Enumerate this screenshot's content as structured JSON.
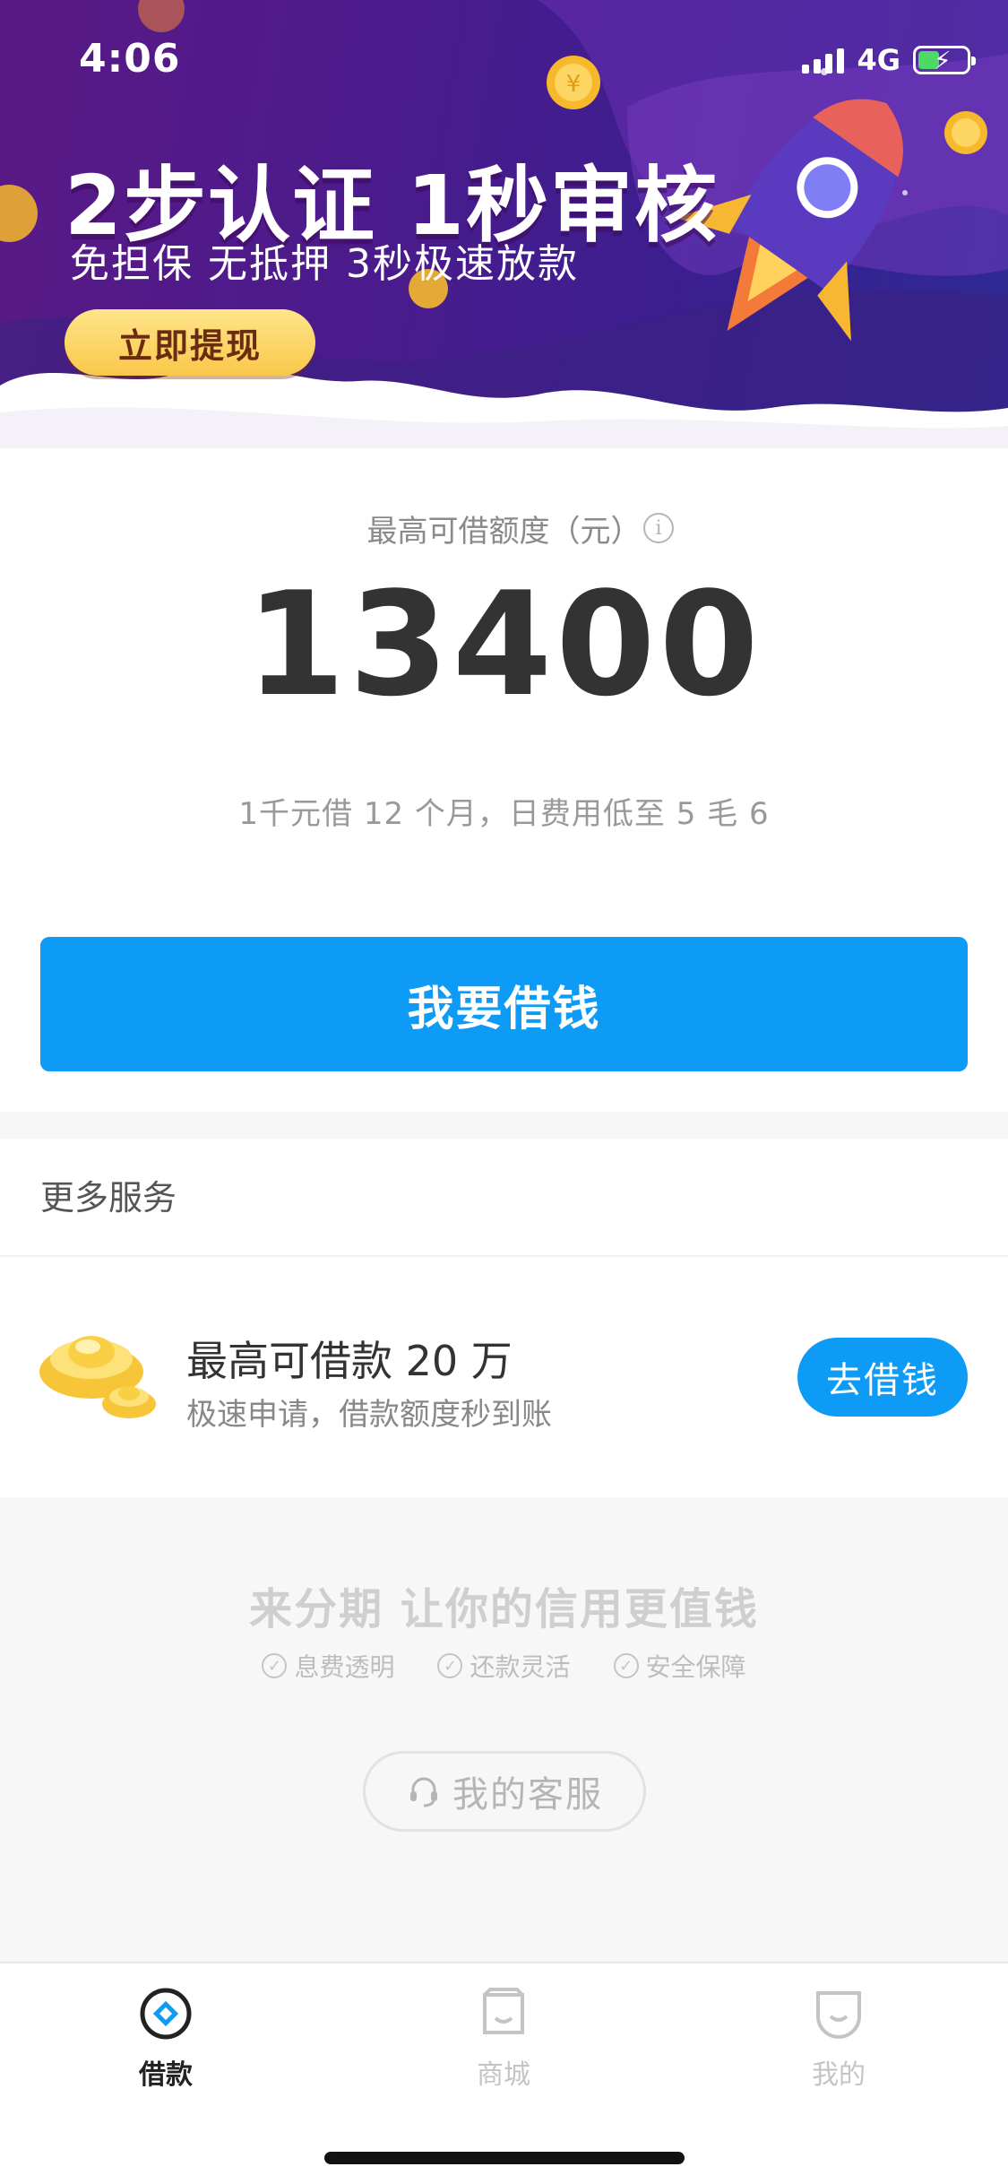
{
  "status_bar": {
    "time": "4:06",
    "network": "4G",
    "battery_level": 0.45
  },
  "banner": {
    "title": "2步认证 1秒审核",
    "subtitle": "免担保 无抵押 3秒极速放款",
    "button_label": "立即提现"
  },
  "quota": {
    "label": "最高可借额度（元）",
    "amount": "13400",
    "note": "1千元借 12 个月，日费用低至 5 毛 6"
  },
  "borrow_button": {
    "label": "我要借钱"
  },
  "more_services": {
    "title": "更多服务",
    "item": {
      "title": "最高可借款 20 万",
      "subtitle": "极速申请，借款额度秒到账",
      "button_label": "去借钱"
    }
  },
  "footer": {
    "slogan": "来分期 让你的信用更值钱",
    "features": [
      "息费透明",
      "还款灵活",
      "安全保障"
    ],
    "customer_service_label": "我的客服"
  },
  "tabbar": {
    "tabs": [
      {
        "label": "借款",
        "icon": "loan-icon",
        "active": true
      },
      {
        "label": "商城",
        "icon": "shop-icon",
        "active": false
      },
      {
        "label": "我的",
        "icon": "profile-icon",
        "active": false
      }
    ]
  },
  "colors": {
    "primary": "#0d9bf6",
    "banner_purple": "#4a1b8c",
    "banner_button": "#f9c84a"
  }
}
